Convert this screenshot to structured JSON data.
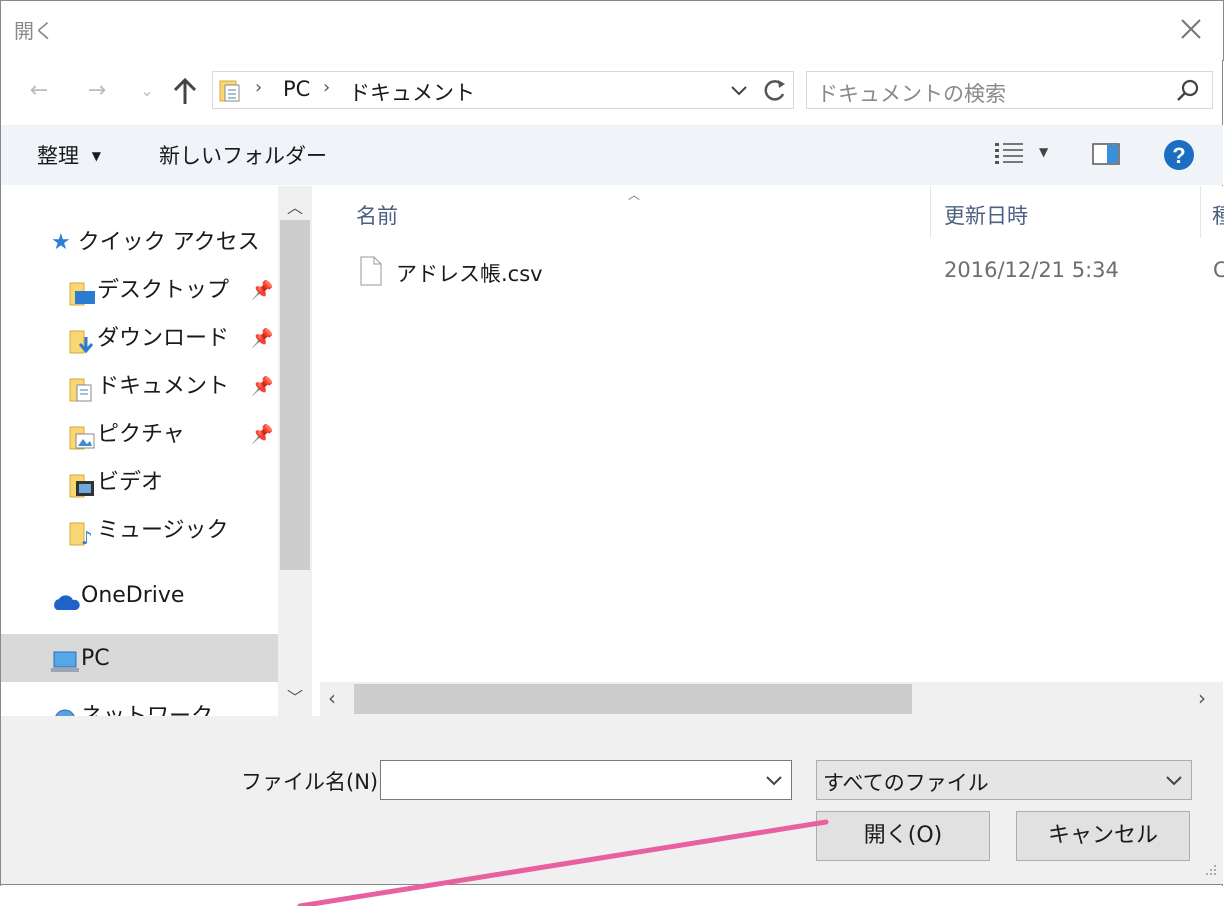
{
  "window": {
    "title": "開く"
  },
  "addressbar": {
    "crumbs": [
      "PC",
      "ドキュメント"
    ],
    "search_placeholder": "ドキュメントの検索"
  },
  "toolbar": {
    "organize": "整理",
    "new_folder": "新しいフォルダー"
  },
  "nav": {
    "quick_access": "クイック アクセス",
    "items": [
      "デスクトップ",
      "ダウンロード",
      "ドキュメント",
      "ピクチャ",
      "ビデオ",
      "ミュージック"
    ],
    "onedrive": "OneDrive",
    "pc": "PC",
    "network_partial": "ネットワーク"
  },
  "filelist": {
    "columns": {
      "name": "名前",
      "modified": "更新日時",
      "type_partial": "種",
      "size_partial": "C"
    },
    "files": [
      {
        "name": "アドレス帳.csv",
        "modified": "2016/12/21 5:34"
      }
    ]
  },
  "footer": {
    "filename_label": "ファイル名(N):",
    "filename_value": "",
    "filter": "すべてのファイル",
    "open_button": "開く(O)",
    "cancel_button": "キャンセル"
  },
  "colors": {
    "annotation_line": "#e8609f",
    "help": "#1b6ec2",
    "selected_row": "#d9d9d9"
  }
}
